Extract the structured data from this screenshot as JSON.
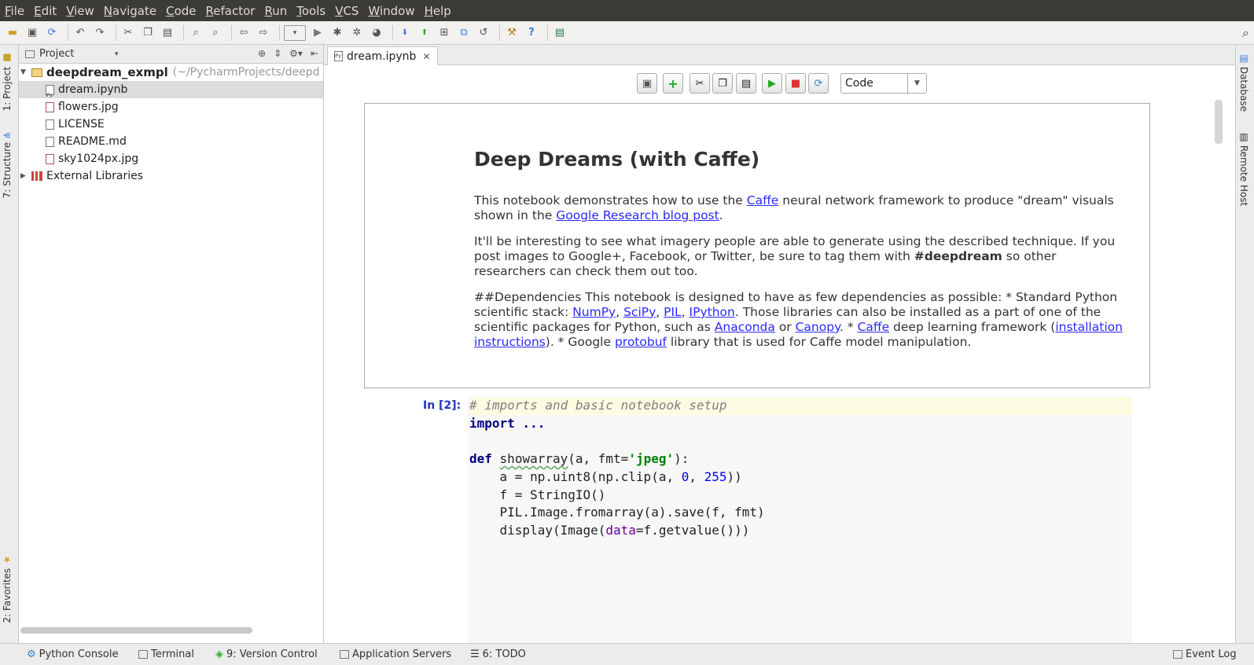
{
  "menu": [
    "File",
    "Edit",
    "View",
    "Navigate",
    "Code",
    "Refactor",
    "Run",
    "Tools",
    "VCS",
    "Window",
    "Help"
  ],
  "left_stripe": {
    "project_tab": "1: Project",
    "structure_tab": "7: Structure",
    "favorites_tab": "2: Favorites"
  },
  "right_stripe": {
    "database_tab": "Database",
    "remote_host_tab": "Remote Host"
  },
  "project_panel": {
    "header": "Project",
    "root": {
      "name": "deepdream_exmpl",
      "path": "(~/PycharmProjects/deepd"
    },
    "files": [
      "dream.ipynb",
      "flowers.jpg",
      "LICENSE",
      "README.md",
      "sky1024px.jpg"
    ],
    "external": "External Libraries"
  },
  "editor": {
    "tab_label": "dream.ipynb",
    "cell_type": "Code"
  },
  "markdown": {
    "title": "Deep Dreams (with Caffe)",
    "p1_a": "This notebook demonstrates how to use the ",
    "p1_link1": "Caffe",
    "p1_b": " neural network framework to produce \"dream\" visuals shown in the ",
    "p1_link2": "Google Research blog post",
    "p1_c": ".",
    "p2_a": "It'll be interesting to see what imagery people are able to generate using the described technique. If you post images to Google+, Facebook, or Twitter, be sure to tag them with ",
    "p2_bold": "#deepdream",
    "p2_b": " so other researchers can check them out too.",
    "p3_a": "##Dependencies This notebook is designed to have as few dependencies as possible: * Standard Python scientific stack: ",
    "l_numpy": "NumPy",
    "sep1": ", ",
    "l_scipy": "SciPy",
    "sep2": ", ",
    "l_pil": "PIL",
    "sep3": ", ",
    "l_ipython": "IPython",
    "p3_b": ". Those libraries can also be installed as a part of one of the scientific packages for Python, such as ",
    "l_anaconda": "Anaconda",
    "p3_c": " or ",
    "l_canopy": "Canopy",
    "p3_d": ". * ",
    "l_caffe": "Caffe",
    "p3_e": " deep learning framework (",
    "l_install": "installation instructions",
    "p3_f": "). * Google ",
    "l_protobuf": "protobuf",
    "p3_g": " library that is used for Caffe model manipulation."
  },
  "code_cell": {
    "prompt": "In [2]:",
    "line1": "# imports and basic notebook setup",
    "line2_kw": "import",
    "line2_rest": " ...",
    "def_kw": "def",
    "def_name": "showarray",
    "def_args_a": "(a, fmt=",
    "def_str": "'jpeg'",
    "def_args_b": "):",
    "l5_a": "    a = np.uint8(np.clip(a, ",
    "l5_n1": "0",
    "l5_b": ", ",
    "l5_n2": "255",
    "l5_c": "))",
    "l6": "    f = StringIO()",
    "l7": "    PIL.Image.fromarray(a).save(f, fmt)",
    "l8_a": "    display(Image(",
    "l8_param": "data",
    "l8_b": "=f.getvalue()))"
  },
  "status_bar": {
    "python_console": "Python Console",
    "terminal": "Terminal",
    "version_control": "9: Version Control",
    "app_servers": "Application Servers",
    "todo": "6: TODO",
    "event_log": "Event Log"
  }
}
